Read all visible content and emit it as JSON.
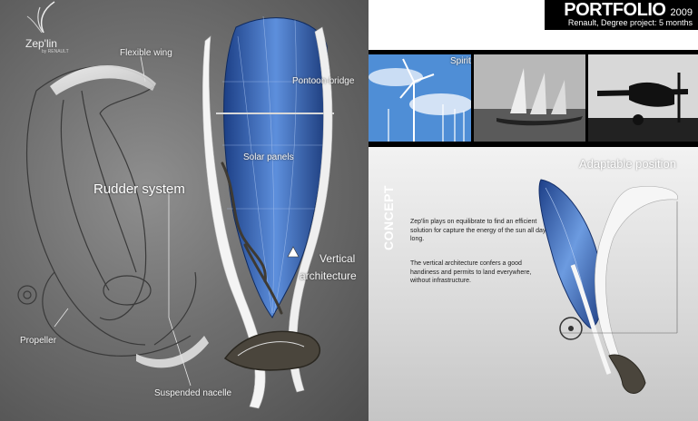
{
  "brand": {
    "name": "Zep'lin",
    "sub": "by RENAULT"
  },
  "header": {
    "title": "PORTFOLIO",
    "year": "2009",
    "subtitle": "Renault, Degree project: 5 months"
  },
  "labels": {
    "flexible_wing": "Flexible wing",
    "pontoon_bridge": "Pontoon-bridge",
    "solar_panels": "Solar panels",
    "rudder_system": "Rudder system",
    "vertical": "Vertical",
    "architecture": "architecture",
    "propeller": "Propeller",
    "suspended_nacelle": "Suspended nacelle"
  },
  "photos": {
    "spirit_caption": "Spirit"
  },
  "concept": {
    "title": "Adaptable position",
    "paragraph1": "Zep'lin plays on equilibrate to find an efficient solution for capture the energy of the sun all day long.",
    "paragraph2": "The vertical architecture confers a good handiness and permits to land everywhere, without infrastructure.",
    "section_label": "CONCEPT"
  },
  "colors": {
    "panel_blue": "#2f5fb0",
    "background_black": "#000000",
    "header_white": "#ffffff"
  }
}
